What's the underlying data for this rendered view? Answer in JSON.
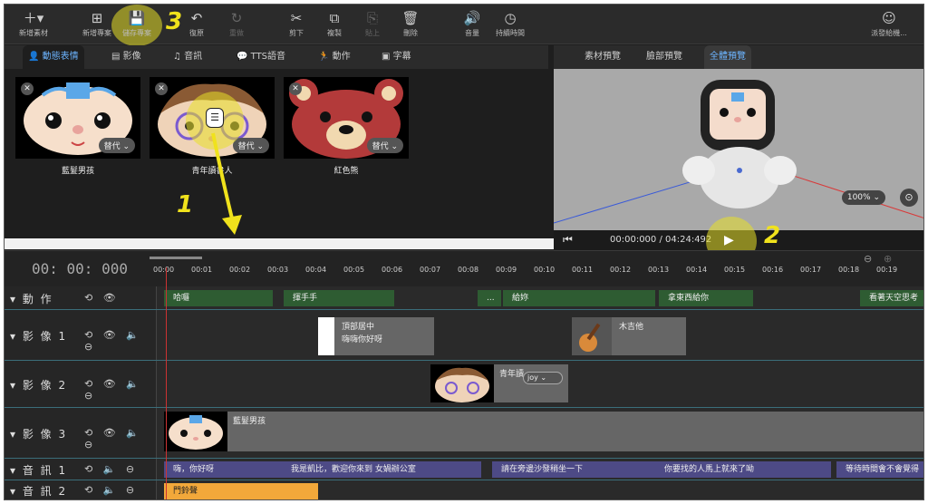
{
  "toolbar": {
    "items": [
      {
        "label": "新增素材",
        "icon": "plus-icon"
      },
      {
        "label": "新增專案",
        "icon": "new-project-icon"
      },
      {
        "label": "儲存專案",
        "icon": "save-icon"
      },
      {
        "label": "復原",
        "icon": "undo-icon"
      },
      {
        "label": "重做",
        "icon": "redo-icon"
      },
      {
        "label": "剪下",
        "icon": "scissors-icon"
      },
      {
        "label": "複製",
        "icon": "copy-icon"
      },
      {
        "label": "貼上",
        "icon": "paste-icon"
      },
      {
        "label": "刪除",
        "icon": "trash-icon"
      },
      {
        "label": "音量",
        "icon": "volume-icon"
      },
      {
        "label": "持續時間",
        "icon": "clock-icon"
      },
      {
        "label": "派發給機...",
        "icon": "robot-dispatch-icon"
      }
    ]
  },
  "callouts": {
    "one": "1",
    "two": "2",
    "three": "3"
  },
  "tabs": [
    "動態表情",
    "影像",
    "音訊",
    "TTS語音",
    "動作",
    "字幕"
  ],
  "preview_tabs": [
    "素材預覽",
    "臉部預覽",
    "全體預覽"
  ],
  "assets": [
    {
      "name": "藍髮男孩",
      "replace": "替代"
    },
    {
      "name": "青年讀書人",
      "replace": "替代"
    },
    {
      "name": "紅色熊",
      "replace": "替代"
    }
  ],
  "preview": {
    "zoom": "100%",
    "time": "00:00:000 / 04:24:492"
  },
  "timeline": {
    "timecode": "00: 00: 000",
    "ticks": [
      "00:00",
      "00:01",
      "00:02",
      "00:03",
      "00:04",
      "00:05",
      "00:06",
      "00:07",
      "00:08",
      "00:09",
      "00:10",
      "00:11",
      "00:12",
      "00:13",
      "00:14",
      "00:15",
      "00:16",
      "00:17",
      "00:18",
      "00:19"
    ]
  },
  "tracks": [
    {
      "label": "動 作",
      "clips": [
        "哈囉",
        "揮手手",
        "...",
        "給妳",
        "拿東西給你",
        "看著天空思考"
      ]
    },
    {
      "label": "影 像 1",
      "clips": [
        "頂部居中",
        "嗨嗨你好呀",
        "木吉他"
      ]
    },
    {
      "label": "影 像 2",
      "clips": [
        "青年讀",
        "joy"
      ]
    },
    {
      "label": "影 像 3",
      "clips": [
        "藍髮男孩"
      ]
    },
    {
      "label": "音 訊 1",
      "clips": [
        "嗨，你好呀",
        "我是凱比，歡迎你來到 女媧辦公室",
        "請在旁邊沙發稍坐一下",
        "你要找的人馬上就來了呦",
        "等待時間會不會覺得"
      ]
    },
    {
      "label": "音 訊 2",
      "clips": [
        "門鈴聲"
      ]
    }
  ]
}
